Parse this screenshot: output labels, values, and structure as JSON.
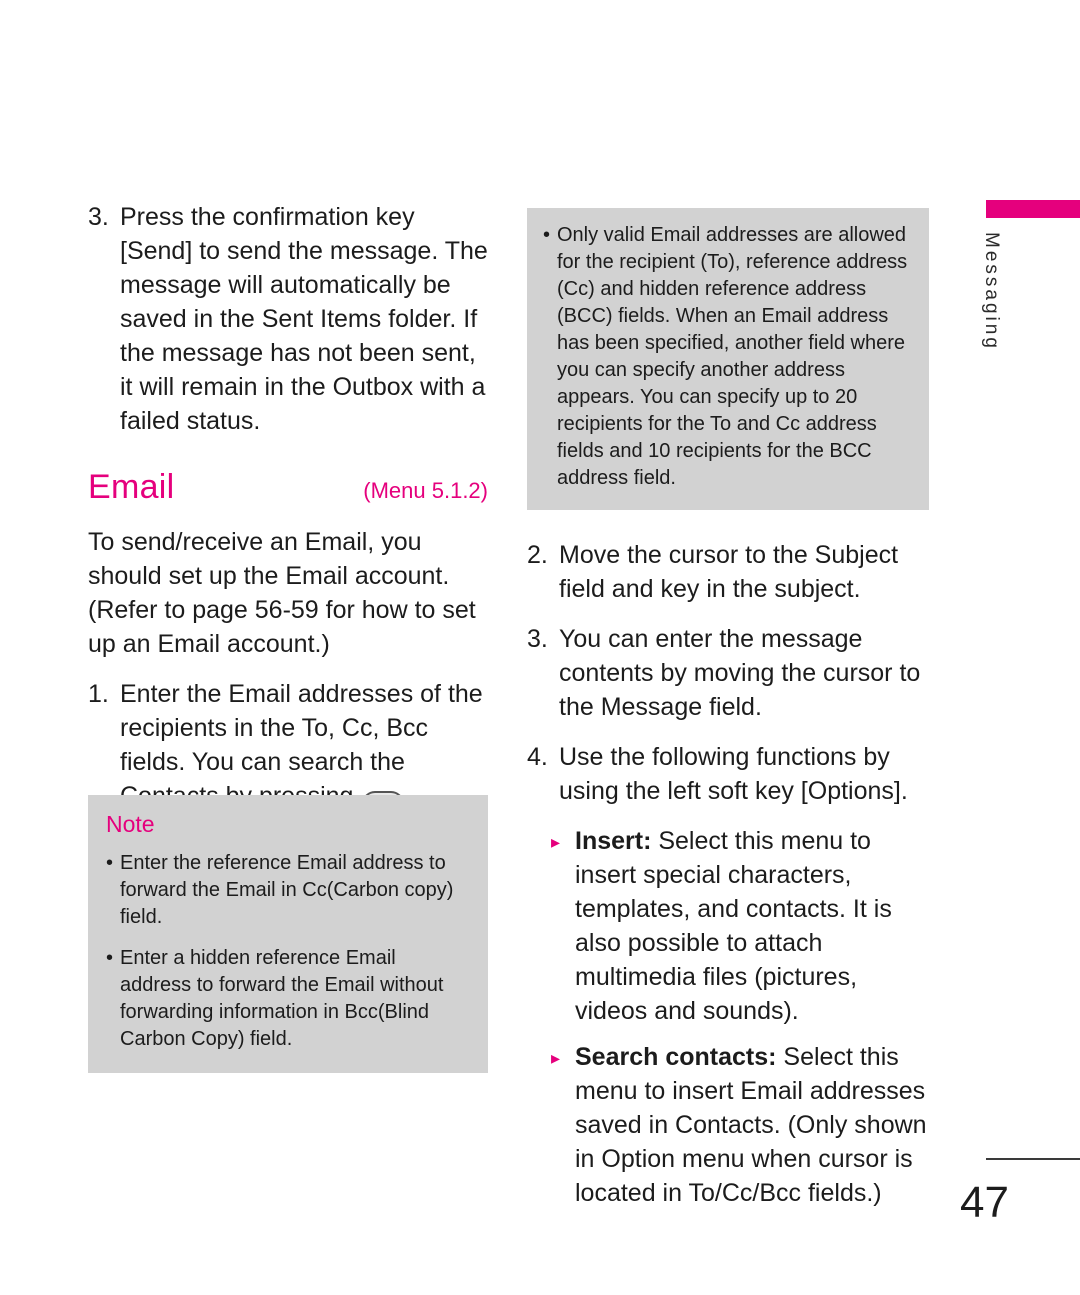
{
  "page": {
    "number": "47",
    "tab_label": "Messaging"
  },
  "left_column": {
    "step3": {
      "num": "3.",
      "text": "Press the confirmation key [Send] to send the message. The message will automatically be saved in the Sent Items folder. If the message has not been sent, it will remain in the Outbox with a failed status."
    },
    "heading": {
      "title": "Email",
      "menu": "(Menu 5.1.2)"
    },
    "intro": "To send/receive an Email, you should set up the Email account. (Refer to page 56-59 for how to set up an Email account.)",
    "step1": {
      "num": "1.",
      "text_before": "Enter the Email addresses of the recipients in the To, Cc, Bcc fields. You can search the Contacts by pressing",
      "key_label": "OK",
      "text_after": "."
    }
  },
  "note_box": {
    "title": "Note",
    "bullets": [
      {
        "marker": "•",
        "text": "Enter the reference Email address to forward the Email in Cc(Carbon copy) field."
      },
      {
        "marker": "•",
        "text": "Enter a hidden reference Email address to forward the Email without forwarding information in Bcc(Blind Carbon Copy) field."
      }
    ]
  },
  "right_column": {
    "info_box": {
      "marker": "•",
      "text": "Only valid Email addresses are allowed for the recipient (To), reference address (Cc) and hidden reference address (BCC) fields. When an Email address has been specified, another field where you can specify another address appears. You can specify up to 20 recipients for the To and Cc address fields and 10 recipients for the BCC address field."
    },
    "step2": {
      "num": "2.",
      "text": "Move the cursor to the Subject field and key in the subject."
    },
    "step3": {
      "num": "3.",
      "text": "You can enter the message contents by moving the cursor to the Message field."
    },
    "step4": {
      "num": "4.",
      "text": "Use the following functions by using the left soft key [Options]."
    },
    "options": [
      {
        "marker": "▸",
        "lead": "Insert:",
        "text": " Select this menu to insert special characters, templates, and contacts. It is also possible to attach multimedia files (pictures, videos and sounds)."
      },
      {
        "marker": "▸",
        "lead": "Search contacts:",
        "text": " Select this menu to insert Email addresses saved in Contacts. (Only shown in Option menu when cursor is located in To/Cc/Bcc fields.)"
      }
    ]
  },
  "colors": {
    "accent": "#e5007d",
    "box_gray": "#d2d2d2"
  }
}
